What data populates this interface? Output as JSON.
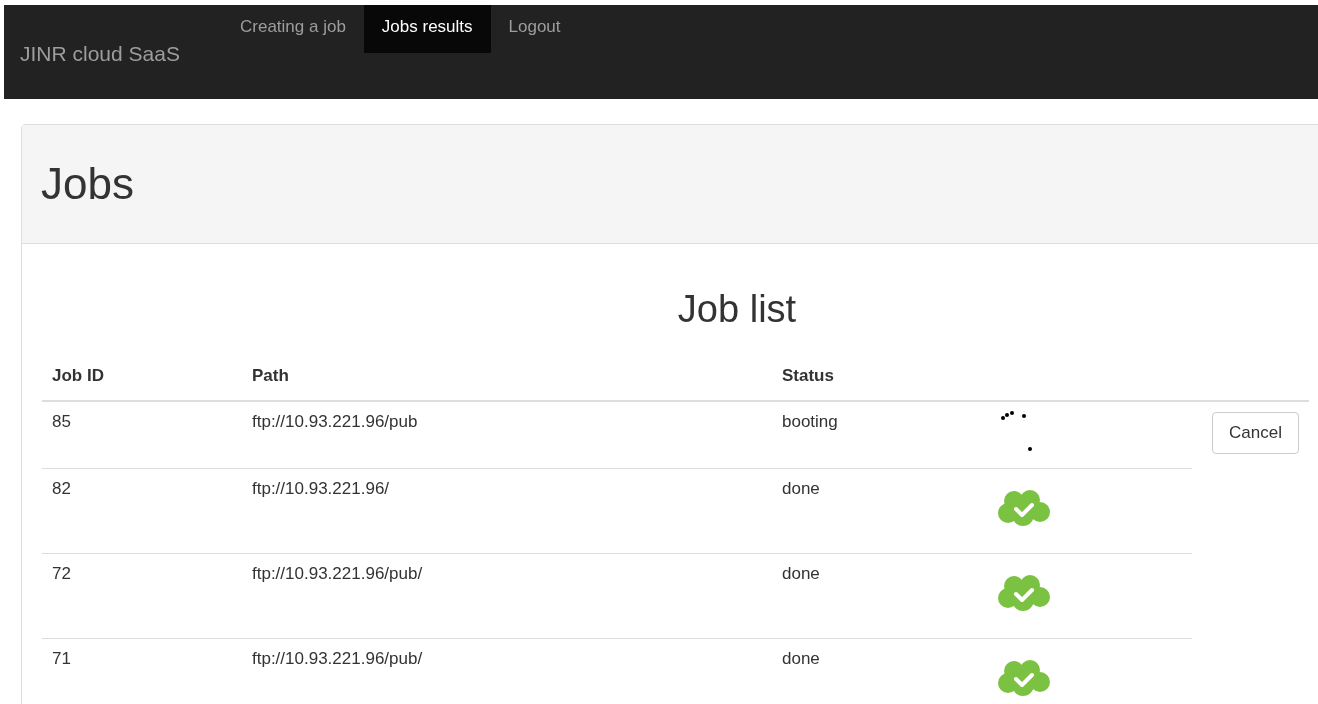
{
  "navbar": {
    "brand": "JINR cloud SaaS",
    "items": [
      {
        "label": "Creating a job",
        "selected": false
      },
      {
        "label": "Jobs results",
        "selected": true
      },
      {
        "label": "Logout",
        "selected": false
      }
    ]
  },
  "panel": {
    "title": "Jobs"
  },
  "table": {
    "title": "Job list",
    "columns": [
      "Job ID",
      "Path",
      "Status"
    ],
    "rows": [
      {
        "job_id": "85",
        "path": "ftp://10.93.221.96/pub",
        "status": "booting",
        "kind": "running",
        "action": "Cancel"
      },
      {
        "job_id": "82",
        "path": "ftp://10.93.221.96/",
        "status": "done",
        "kind": "done"
      },
      {
        "job_id": "72",
        "path": "ftp://10.93.221.96/pub/",
        "status": "done",
        "kind": "done"
      },
      {
        "job_id": "71",
        "path": "ftp://10.93.221.96/pub/",
        "status": "done",
        "kind": "done"
      }
    ]
  }
}
